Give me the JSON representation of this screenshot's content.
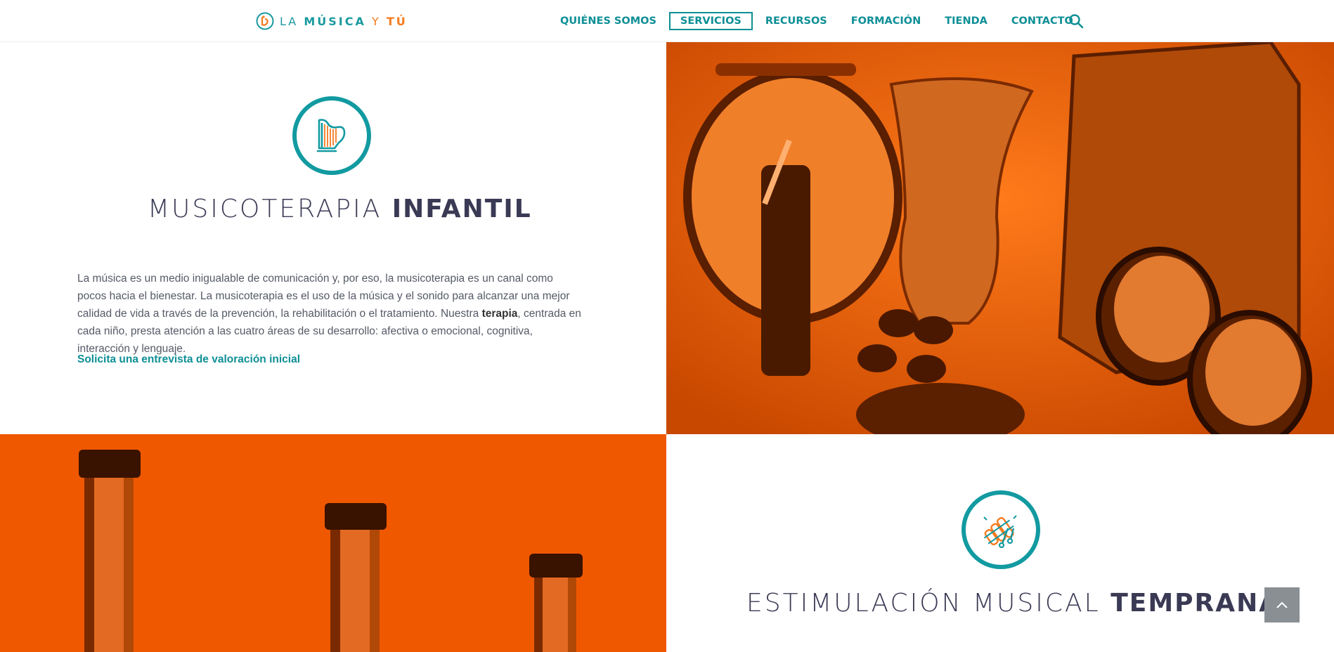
{
  "header": {
    "logo": {
      "la": "LA",
      "musica": "MÚSICA",
      "y": "Y",
      "tu": "TÚ"
    },
    "nav": [
      {
        "label": "QUIÉNES SOMOS",
        "active": false
      },
      {
        "label": "SERVICIOS",
        "active": true
      },
      {
        "label": "RECURSOS",
        "active": false
      },
      {
        "label": "FORMACIÓN",
        "active": false
      },
      {
        "label": "TIENDA",
        "active": false
      },
      {
        "label": "CONTACTO",
        "active": false
      }
    ],
    "search_icon": "search-icon"
  },
  "section1": {
    "icon": "harp-icon",
    "title_light": "MUSICOTERAPIA",
    "title_bold": "INFANTIL",
    "paragraph_part1": "La música es un medio inigualable de comunicación y, por eso, la musicoterapia es un canal como pocos hacia el bienestar. La musicoterapia es el uso de la música y el sonido para alcanzar una mejor calidad de vida a través de la prevención, la rehabilitación o el tratamiento. Nuestra ",
    "paragraph_bold": "terapia",
    "paragraph_part2": ", centrada en cada niño, presta atención a las cuatro áreas de su desarrollo: afectiva o emocional, cognitiva, interacción y lenguaje.",
    "cta": "Solicita una entrevista de valoración inicial",
    "image": "percussion-instruments-photo"
  },
  "section2": {
    "icon": "xylophone-icon",
    "title_light": "ESTIMULACIÓN MUSICAL",
    "title_bold": "TEMPRANA",
    "image": "pipes-photo"
  },
  "scroll_top": "chevron-up-icon",
  "colors": {
    "teal": "#129aa1",
    "orange": "#e85a00",
    "dark": "#3a3a55"
  }
}
